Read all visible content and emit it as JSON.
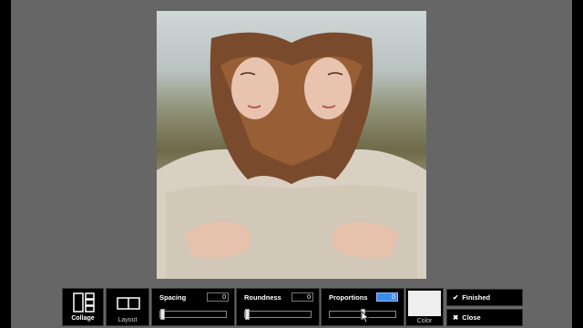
{
  "toolbar": {
    "collage_label": "Collage",
    "layout_label": "Layout",
    "spacing": {
      "label": "Spacing",
      "value": "0",
      "level": 0.0
    },
    "roundness": {
      "label": "Roundness",
      "value": "0",
      "level": 0.0
    },
    "proportions": {
      "label": "Proportions",
      "value": "0",
      "level": 0.5
    },
    "color_label": "Color",
    "finished_label": "Finished",
    "close_label": "Close"
  },
  "colors": {
    "canvas_bg": "#666666",
    "toolbar_bg": "#000000",
    "accent": "#3d8bea",
    "swatch": "#eeeeee"
  },
  "icons": [
    "collage-icon",
    "layout-icon",
    "checkmark-icon",
    "close-icon",
    "mouse-cursor-icon"
  ]
}
